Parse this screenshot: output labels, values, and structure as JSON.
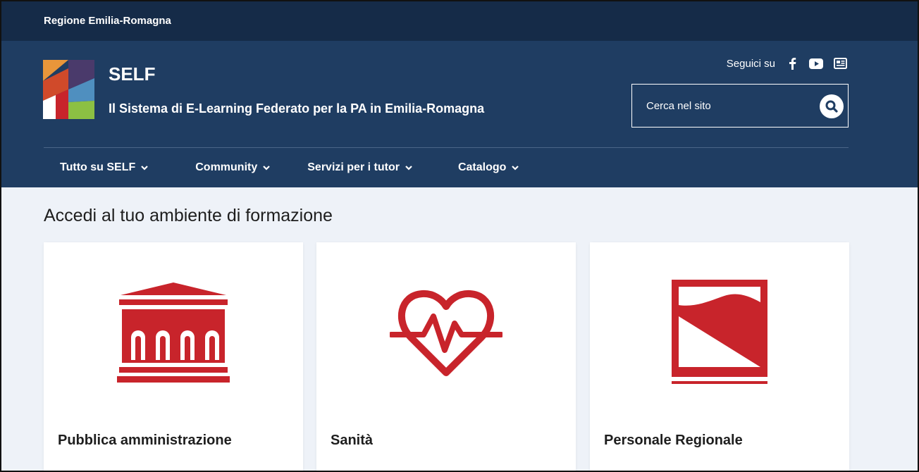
{
  "topbar": {
    "region_link": "Regione Emilia-Romagna"
  },
  "header": {
    "title": "SELF",
    "subtitle": "Il Sistema di E-Learning Federato per la PA in Emilia-Romagna",
    "social_label": "Seguici su",
    "social_icons": [
      "facebook-icon",
      "youtube-icon",
      "newsletter-icon"
    ],
    "search": {
      "placeholder": "Cerca nel sito"
    }
  },
  "nav": {
    "items": [
      {
        "label": "Tutto su SELF"
      },
      {
        "label": "Community"
      },
      {
        "label": "Servizi per i tutor"
      },
      {
        "label": "Catalogo"
      }
    ]
  },
  "main": {
    "heading": "Accedi al tuo ambiente di formazione",
    "cards": [
      {
        "label": "Pubblica amministrazione",
        "icon": "building-icon"
      },
      {
        "label": "Sanità",
        "icon": "heart-pulse-icon"
      },
      {
        "label": "Personale Regionale",
        "icon": "region-flag-icon"
      }
    ]
  },
  "colors": {
    "topbar_bg": "#152b48",
    "header_bg": "#1f3d62",
    "accent_red": "#c8242b",
    "page_bg": "#eef2f8"
  }
}
